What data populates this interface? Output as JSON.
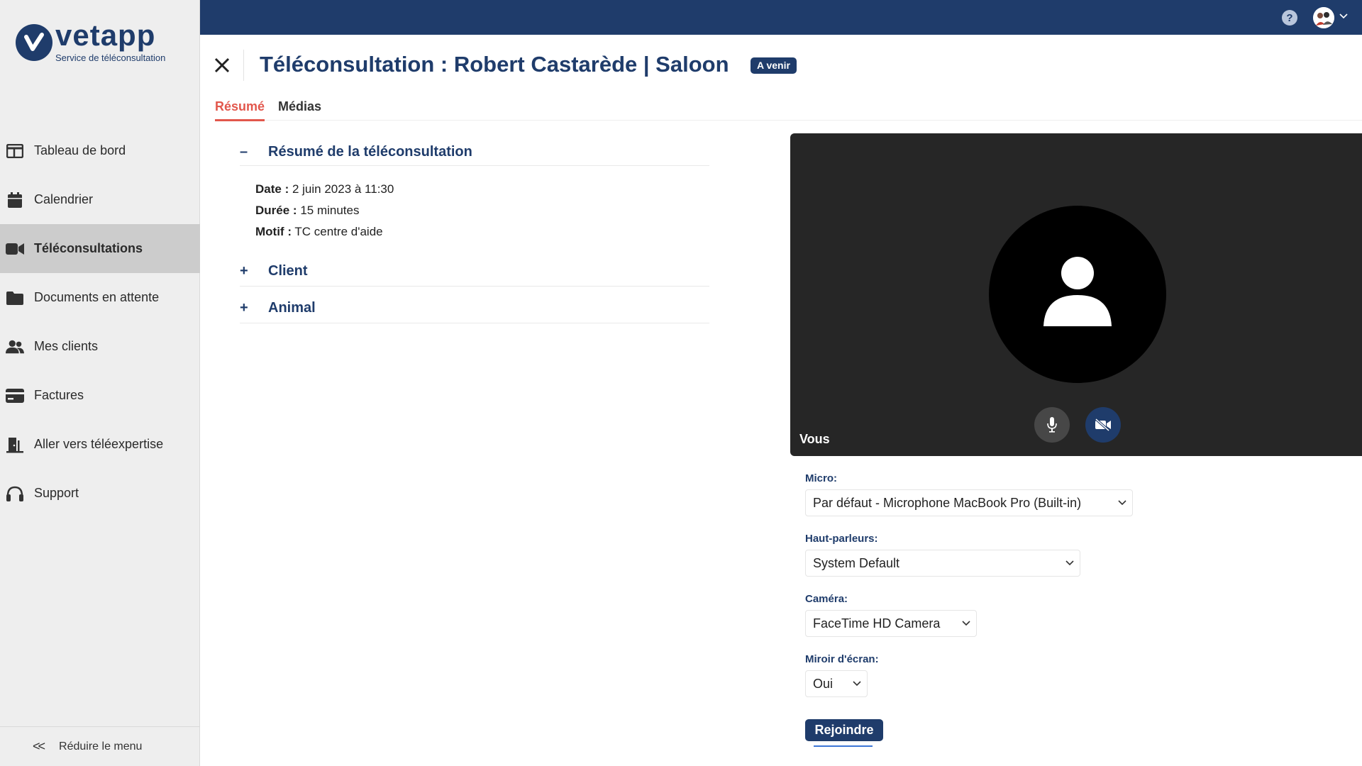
{
  "brand": {
    "name": "vetapp",
    "subtitle": "Service de téléconsultation",
    "color": "#1f3c6b"
  },
  "sidebar": {
    "items": [
      {
        "label": "Tableau de bord",
        "icon": "dashboard-icon"
      },
      {
        "label": "Calendrier",
        "icon": "calendar-icon"
      },
      {
        "label": "Téléconsultations",
        "icon": "video-camera-icon",
        "active": true
      },
      {
        "label": "Documents en attente",
        "icon": "folder-icon"
      },
      {
        "label": "Mes clients",
        "icon": "users-icon"
      },
      {
        "label": "Factures",
        "icon": "credit-card-icon"
      },
      {
        "label": "Aller vers téléexpertise",
        "icon": "door-exit-icon"
      },
      {
        "label": "Support",
        "icon": "headset-icon"
      }
    ],
    "collapse_label": "Réduire le menu"
  },
  "topbar": {
    "help_glyph": "?",
    "color": "#1f3c6b"
  },
  "header": {
    "title": "Téléconsultation : Robert Castarède | Saloon",
    "status_badge": "A venir"
  },
  "tabs": [
    {
      "label": "Résumé",
      "active": true
    },
    {
      "label": "Médias",
      "active": false
    }
  ],
  "summary": {
    "section_title": "Résumé de la téléconsultation",
    "expanded_sign": "–",
    "date_label": "Date :",
    "date_value": "2 juin 2023 à 11:30",
    "duration_label": "Durée :",
    "duration_value": "15 minutes",
    "reason_label": "Motif :",
    "reason_value": "TC centre d'aide",
    "client_title": "Client",
    "animal_title": "Animal",
    "collapsed_sign": "+"
  },
  "video": {
    "self_label": "Vous",
    "camera_off": true
  },
  "devices": {
    "mic_label": "Micro:",
    "mic_value": "Par défaut - Microphone MacBook Pro (Built-in)",
    "speakers_label": "Haut-parleurs:",
    "speakers_value": "System Default",
    "camera_label": "Caméra:",
    "camera_value": "FaceTime HD Camera",
    "mirror_label": "Miroir d'écran:",
    "mirror_value": "Oui"
  },
  "join_label": "Rejoindre",
  "colors": {
    "accent_red": "#e2574c",
    "primary_navy": "#1f3c6b",
    "sidebar_bg": "#eeeeee",
    "sidebar_active": "#cccccc"
  }
}
